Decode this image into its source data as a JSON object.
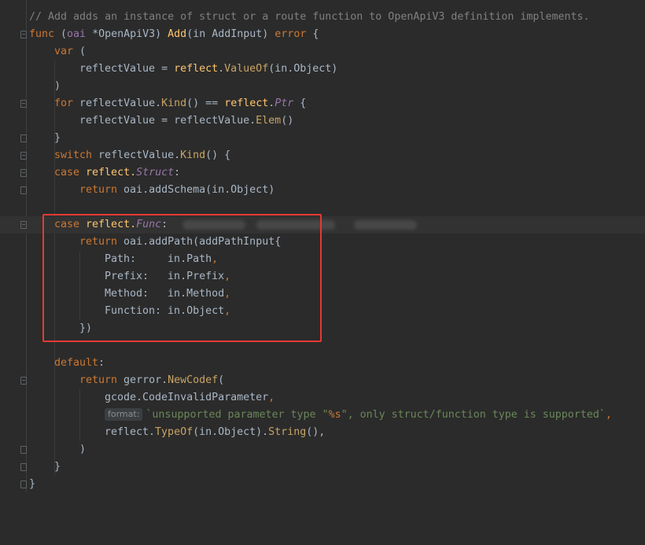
{
  "lines": [
    {
      "comment": "// Add adds an instance of struct or a route function to OpenApiV3 definition implements."
    },
    {
      "kw_func": "func",
      "p1": " (",
      "recv": "oai",
      "star": " *",
      "recv_type": "OpenApiV3",
      "p2": ") ",
      "fname": "Add",
      "p3": "(in ",
      "param_type": "AddInput",
      "p4": ") ",
      "ret": "error",
      "p5": " {"
    },
    {
      "kw": "var",
      "rest": " ("
    },
    {
      "a": "reflectValue = ",
      "b": "reflect",
      "c": ".",
      "d": "ValueOf",
      "e": "(in.Object)"
    },
    {
      "a": ")"
    },
    {
      "kw": "for",
      "a": " reflectValue.",
      "b": "Kind",
      "c": "() == ",
      "d": "reflect",
      "e": ".",
      "f": "Ptr",
      "g": " {"
    },
    {
      "a": "reflectValue = reflectValue.",
      "b": "Elem",
      "c": "()"
    },
    {
      "a": "}"
    },
    {
      "kw": "switch",
      "a": " reflectValue.",
      "b": "Kind",
      "c": "() {"
    },
    {
      "kw": "case",
      "a": " reflect.",
      "b": "Struct",
      "c": ":"
    },
    {
      "kw": "return",
      "a": " oai.",
      "b": "addSchema",
      "c": "(in.Object)"
    },
    {
      "empty": ""
    },
    {
      "kw": "case",
      "a": " reflect.",
      "b": "Func",
      "c": ":"
    },
    {
      "kw": "return",
      "a": " oai.",
      "b": "addPath",
      "c": "(",
      "d": "addPathInput",
      "e": "{"
    },
    {
      "a": "Path:     in.Path",
      "b": ","
    },
    {
      "a": "Prefix:   in.Prefix",
      "b": ","
    },
    {
      "a": "Method:   in.Method",
      "b": ","
    },
    {
      "a": "Function: in.Object",
      "b": ","
    },
    {
      "a": "})"
    },
    {
      "empty": ""
    },
    {
      "kw": "default",
      "a": ":"
    },
    {
      "kw": "return",
      "a": " gerror.",
      "b": "NewCodef",
      "c": "("
    },
    {
      "a": "gcode.CodeInvalidParameter",
      "b": ","
    },
    {
      "hint": "format:",
      "s1": "`unsupported parameter type \"",
      "fmt": "%s",
      "s2": "\", only struct/function type is supported`",
      "b": ","
    },
    {
      "a": "reflect.",
      "b": "TypeOf",
      "c": "(in.Object).",
      "d": "String",
      "e": "(),"
    },
    {
      "a": ")"
    },
    {
      "a": "}"
    },
    {
      "a": "}"
    }
  ],
  "colors": {
    "background": "#2b2b2b",
    "keyword": "#cc7832",
    "function": "#ffc66d",
    "string": "#6a8759",
    "comment": "#808080",
    "highlight_border": "#e53935"
  }
}
